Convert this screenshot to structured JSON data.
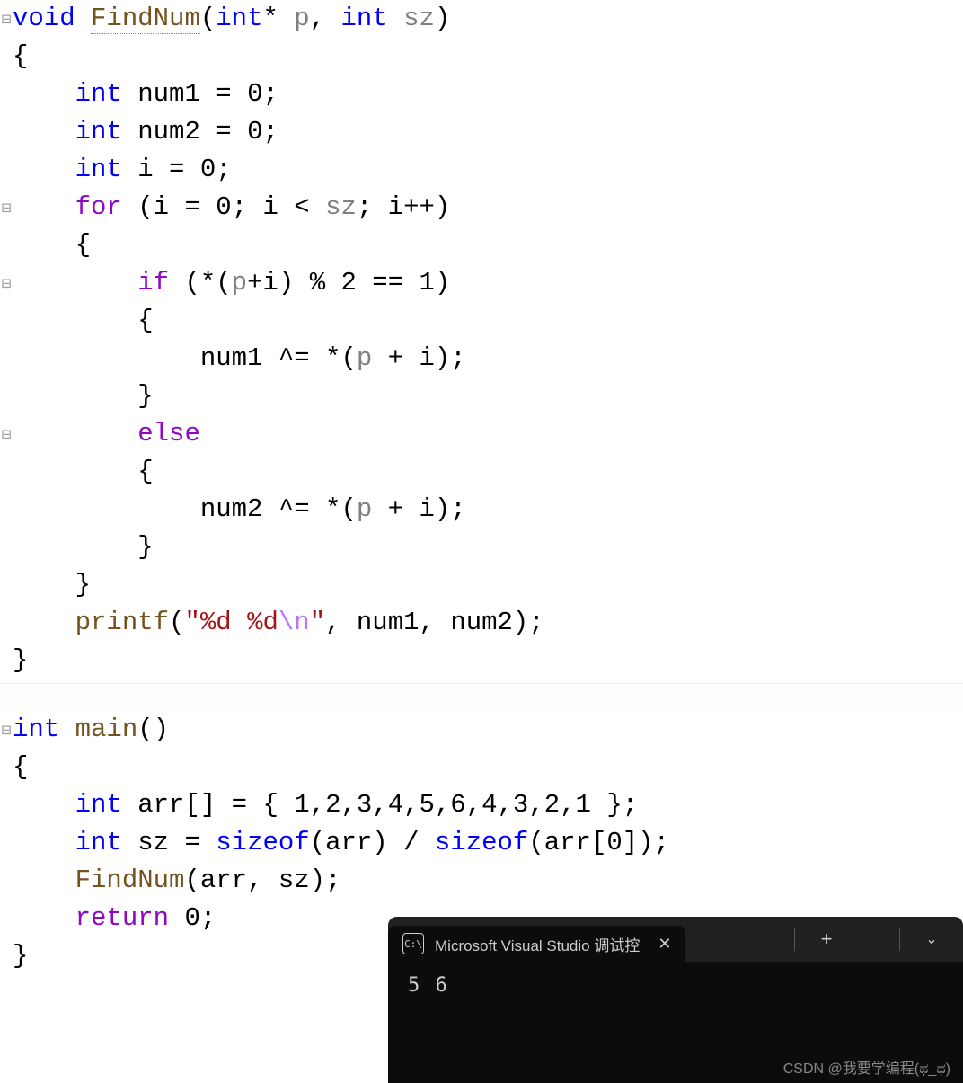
{
  "code": {
    "tokens": [
      [
        {
          "c": "kw-type",
          "t": "void"
        },
        {
          "c": "",
          "t": " "
        },
        {
          "c": "fname",
          "t": "FindNum"
        },
        {
          "c": "",
          "t": "("
        },
        {
          "c": "kw-type",
          "t": "int"
        },
        {
          "c": "",
          "t": "* "
        },
        {
          "c": "param",
          "t": "p"
        },
        {
          "c": "",
          "t": ", "
        },
        {
          "c": "kw-type",
          "t": "int"
        },
        {
          "c": "",
          "t": " "
        },
        {
          "c": "param",
          "t": "sz"
        },
        {
          "c": "",
          "t": ")"
        }
      ],
      [
        {
          "c": "",
          "t": "{"
        }
      ],
      [
        {
          "c": "",
          "t": "    "
        },
        {
          "c": "kw-type",
          "t": "int"
        },
        {
          "c": "",
          "t": " num1 = 0;"
        }
      ],
      [
        {
          "c": "",
          "t": "    "
        },
        {
          "c": "kw-type",
          "t": "int"
        },
        {
          "c": "",
          "t": " num2 = 0;"
        }
      ],
      [
        {
          "c": "",
          "t": "    "
        },
        {
          "c": "kw-type",
          "t": "int"
        },
        {
          "c": "",
          "t": " i = 0;"
        }
      ],
      [
        {
          "c": "",
          "t": "    "
        },
        {
          "c": "kw-ctrl",
          "t": "for"
        },
        {
          "c": "",
          "t": " (i = 0; i < "
        },
        {
          "c": "param",
          "t": "sz"
        },
        {
          "c": "",
          "t": "; i++)"
        }
      ],
      [
        {
          "c": "",
          "t": "    {"
        }
      ],
      [
        {
          "c": "",
          "t": "        "
        },
        {
          "c": "kw-ctrl",
          "t": "if"
        },
        {
          "c": "",
          "t": " (*("
        },
        {
          "c": "param",
          "t": "p"
        },
        {
          "c": "",
          "t": "+i) % 2 == 1)"
        }
      ],
      [
        {
          "c": "",
          "t": "        {"
        }
      ],
      [
        {
          "c": "",
          "t": "            num1 ^= *("
        },
        {
          "c": "param",
          "t": "p"
        },
        {
          "c": "",
          "t": " + i);"
        }
      ],
      [
        {
          "c": "",
          "t": "        }"
        }
      ],
      [
        {
          "c": "",
          "t": "        "
        },
        {
          "c": "kw-ctrl",
          "t": "else"
        }
      ],
      [
        {
          "c": "",
          "t": "        {"
        }
      ],
      [
        {
          "c": "",
          "t": "            num2 ^= *("
        },
        {
          "c": "param",
          "t": "p"
        },
        {
          "c": "",
          "t": " + i);"
        }
      ],
      [
        {
          "c": "",
          "t": "        }"
        }
      ],
      [
        {
          "c": "",
          "t": "    }"
        }
      ],
      [
        {
          "c": "",
          "t": "    "
        },
        {
          "c": "func",
          "t": "printf"
        },
        {
          "c": "",
          "t": "("
        },
        {
          "c": "str",
          "t": "\"%d %d"
        },
        {
          "c": "esc",
          "t": "\\n"
        },
        {
          "c": "str",
          "t": "\""
        },
        {
          "c": "",
          "t": ", num1, num2);"
        }
      ],
      [
        {
          "c": "",
          "t": "}"
        }
      ]
    ],
    "tokens2": [
      [
        {
          "c": "kw-type",
          "t": "int"
        },
        {
          "c": "",
          "t": " "
        },
        {
          "c": "func",
          "t": "main"
        },
        {
          "c": "",
          "t": "()"
        }
      ],
      [
        {
          "c": "",
          "t": "{"
        }
      ],
      [
        {
          "c": "",
          "t": "    "
        },
        {
          "c": "kw-type",
          "t": "int"
        },
        {
          "c": "",
          "t": " arr[] = { 1,2,3,4,5,6,4,3,2,1 };"
        }
      ],
      [
        {
          "c": "",
          "t": "    "
        },
        {
          "c": "kw-type",
          "t": "int"
        },
        {
          "c": "",
          "t": " sz = "
        },
        {
          "c": "sizeof",
          "t": "sizeof"
        },
        {
          "c": "",
          "t": "(arr) / "
        },
        {
          "c": "sizeof",
          "t": "sizeof"
        },
        {
          "c": "",
          "t": "(arr[0]);"
        }
      ],
      [
        {
          "c": "",
          "t": "    "
        },
        {
          "c": "func",
          "t": "FindNum"
        },
        {
          "c": "",
          "t": "(arr, sz);"
        }
      ],
      [
        {
          "c": "",
          "t": "    "
        },
        {
          "c": "kw-ctrl",
          "t": "return"
        },
        {
          "c": "",
          "t": " 0;"
        }
      ],
      [
        {
          "c": "",
          "t": "}"
        }
      ]
    ]
  },
  "gutter1": [
    "⊟",
    "",
    "",
    "",
    "",
    "⊟",
    "",
    "⊟",
    "",
    "",
    "",
    "⊟",
    "",
    "",
    "",
    "",
    "",
    ""
  ],
  "gutter2": [
    "⊟",
    "",
    "",
    "",
    "",
    "",
    ""
  ],
  "terminal": {
    "tab_title": "Microsoft Visual Studio 调试控",
    "cmd_icon_text": "C:\\",
    "output": "5 6"
  },
  "watermark": "CSDN @我要学编程(ಥ_ಥ)"
}
